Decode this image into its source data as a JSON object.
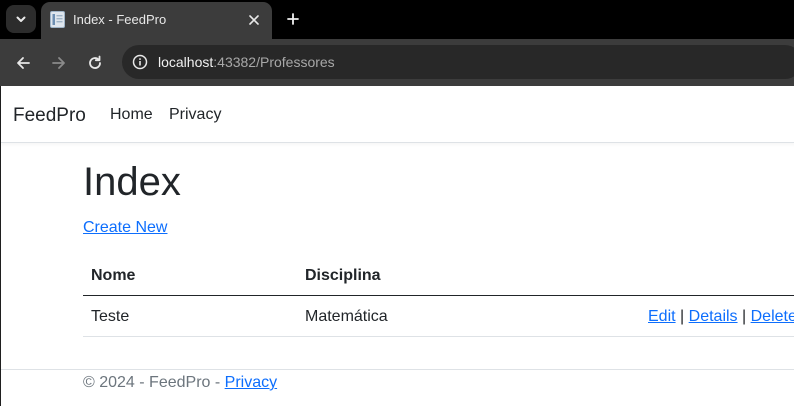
{
  "browser": {
    "tab_title": "Index - FeedPro",
    "url_host": "localhost",
    "url_rest": ":43382/Professores"
  },
  "navbar": {
    "brand": "FeedPro",
    "links": [
      "Home",
      "Privacy"
    ]
  },
  "main": {
    "heading": "Index",
    "create_link": "Create New",
    "table": {
      "headers": [
        "Nome",
        "Disciplina"
      ],
      "rows": [
        {
          "nome": "Teste",
          "disciplina": "Matemática",
          "actions": [
            "Edit",
            "Details",
            "Delete"
          ]
        }
      ],
      "separator": "|"
    }
  },
  "footer": {
    "text": "© 2024 - FeedPro - ",
    "link": "Privacy"
  },
  "icons": {
    "tab_list": "chevron-down-icon",
    "favicon": "document-icon",
    "tab_close": "close-icon",
    "new_tab": "plus-icon",
    "back": "arrow-left-icon",
    "forward": "arrow-right-icon",
    "reload": "reload-icon",
    "site_info": "info-icon"
  },
  "colors": {
    "link": "#0d6efd",
    "text": "#212529",
    "muted": "#6c757d",
    "chrome_dark": "#000000",
    "chrome_toolbar": "#3c3c3c"
  }
}
